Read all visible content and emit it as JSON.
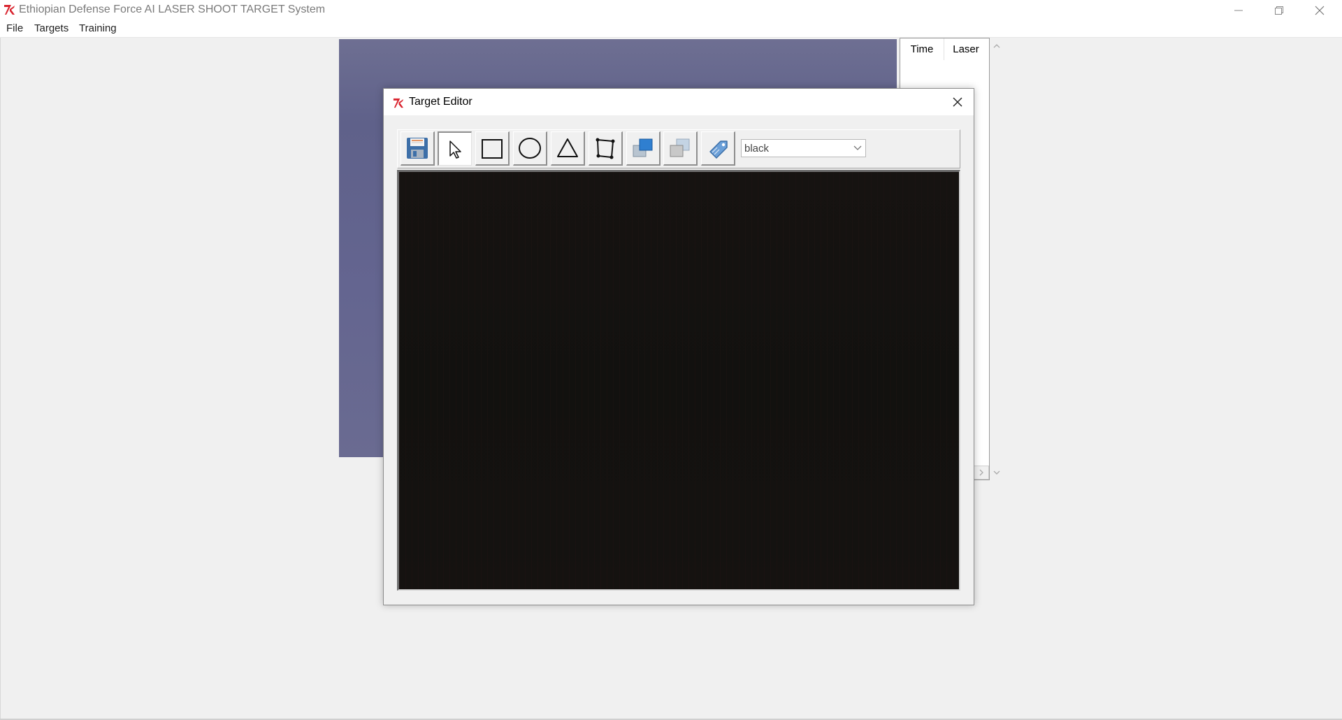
{
  "window": {
    "title": "Ethiopian Defense Force AI LASER SHOOT TARGET System",
    "logo_icon": "tk-feather-icon"
  },
  "menu": {
    "items": [
      "File",
      "Targets",
      "Training"
    ]
  },
  "results_table": {
    "columns": [
      "Time",
      "Laser"
    ]
  },
  "target_editor": {
    "title": "Target Editor",
    "tools": [
      {
        "name": "save",
        "icon": "save-icon",
        "active": false
      },
      {
        "name": "select",
        "icon": "cursor-icon",
        "active": true
      },
      {
        "name": "rectangle",
        "icon": "rectangle-icon",
        "active": false
      },
      {
        "name": "ellipse",
        "icon": "ellipse-icon",
        "active": false
      },
      {
        "name": "triangle",
        "icon": "triangle-icon",
        "active": false
      },
      {
        "name": "freeform",
        "icon": "polygon-icon",
        "active": false
      },
      {
        "name": "bring-forward",
        "icon": "bring-to-front-icon",
        "active": false
      },
      {
        "name": "send-backward",
        "icon": "send-to-back-icon",
        "active": false
      },
      {
        "name": "tag",
        "icon": "tag-icon",
        "active": false
      }
    ],
    "color_select": {
      "value": "black"
    }
  },
  "colors": {
    "canvas": "#141210",
    "video_background": "#65668e",
    "accent_red": "#d9232e"
  }
}
